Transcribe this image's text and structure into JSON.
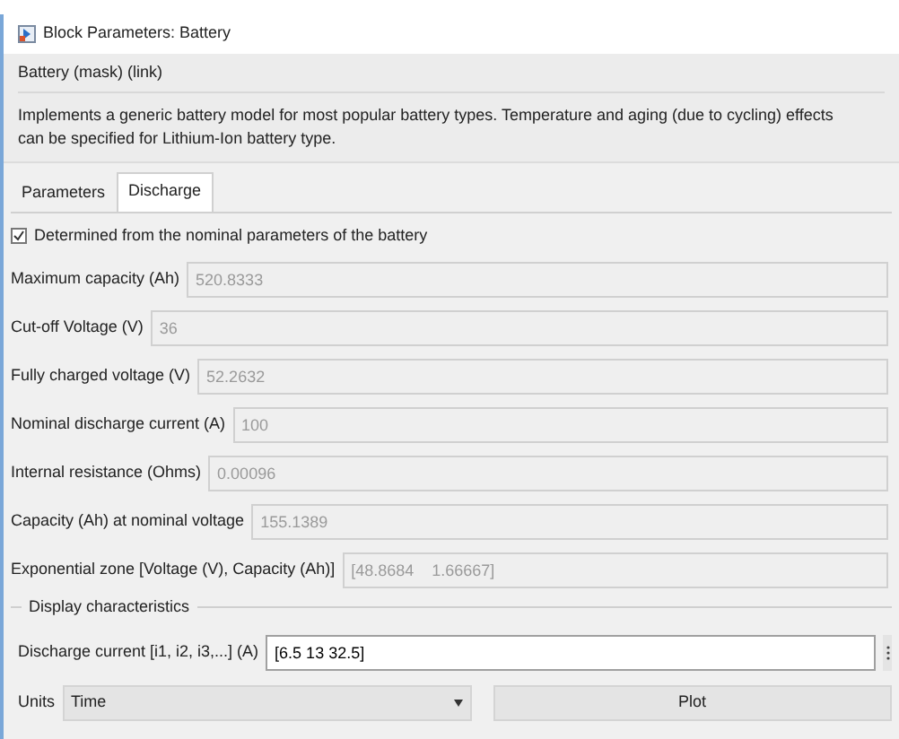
{
  "window": {
    "title": "Block Parameters: Battery"
  },
  "mask": {
    "title": "Battery (mask) (link)",
    "description": "Implements a generic battery model for most popular battery types. Temperature and aging (due to cycling) effects can be specified for Lithium-Ion battery type."
  },
  "tabs": [
    {
      "label": "Parameters",
      "selected": false
    },
    {
      "label": "Discharge",
      "selected": true
    }
  ],
  "determined": {
    "label": "Determined from the nominal parameters of the battery",
    "checked": true
  },
  "fields": [
    {
      "label": "Maximum capacity (Ah)",
      "value": "520.8333",
      "disabled": true
    },
    {
      "label": "Cut-off Voltage (V)",
      "value": "36",
      "disabled": true
    },
    {
      "label": "Fully charged voltage (V)",
      "value": "52.2632",
      "disabled": true
    },
    {
      "label": "Nominal discharge current (A)",
      "value": "100",
      "disabled": true
    },
    {
      "label": "Internal resistance (Ohms)",
      "value": "0.00096",
      "disabled": true
    },
    {
      "label": "Capacity (Ah) at nominal voltage",
      "value": "155.1389",
      "disabled": true
    },
    {
      "label": "Exponential zone [Voltage (V), Capacity (Ah)]",
      "value": "[48.8684    1.66667]",
      "disabled": true
    }
  ],
  "display": {
    "title": "Display characteristics",
    "discharge": {
      "label": "Discharge current [i1, i2, i3,...] (A)",
      "value": "[6.5 13 32.5]",
      "disabled": false
    },
    "units": {
      "label": "Units",
      "value": "Time"
    },
    "plot_button": "Plot"
  }
}
